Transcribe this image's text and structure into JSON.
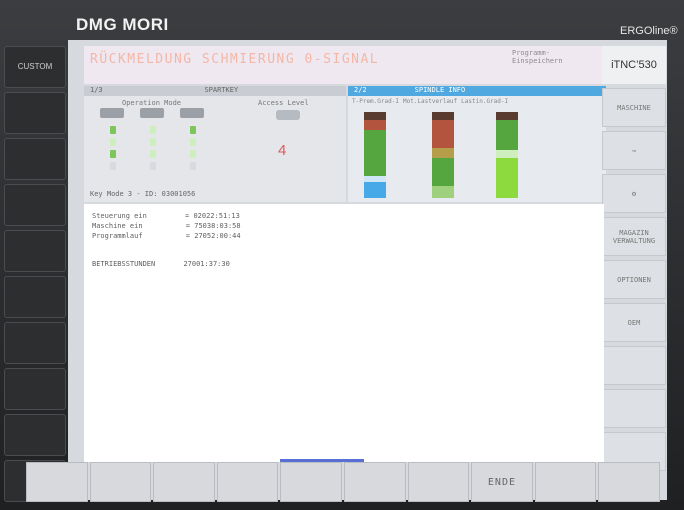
{
  "header": {
    "brand": "DMG MORI",
    "product": "ERGOline®",
    "control": "iTNC’530"
  },
  "left_keys": {
    "custom_label": "CUSTOM"
  },
  "top_message": {
    "text": "RÜCKMELDUNG SCHMIERUNG 0-SIGNAL",
    "program_label": "Programm-\nEinspeichern"
  },
  "panels": {
    "a": {
      "page": "1/3",
      "title": "SPARTKEY",
      "operation_mode_label": "Operation Mode",
      "access_level_label": "Access Level",
      "access_level_value": "4",
      "key_mode": "Key Mode 3 - ID: 03001056"
    },
    "b": {
      "page": "2/2",
      "title": "SPINDLE INFO",
      "labels": [
        "T-Prem.Grad-I",
        "Mot.Lastverlauf",
        "Lastin.Grad-I"
      ]
    }
  },
  "softkeys_right": [
    "MASCHINE",
    "",
    "",
    "MAGAZIN\nVERWALTUNG",
    "OPTIONEN",
    "OEM",
    "",
    "",
    ""
  ],
  "content": {
    "lines": [
      {
        "label": "Steuerung ein",
        "value": "= 02022:51:13"
      },
      {
        "label": "Maschine ein",
        "value": "= 75038:03:58"
      },
      {
        "label": "Programmlauf",
        "value": "= 27052:00:44"
      }
    ],
    "operating_hours": {
      "label": "BETRIEBSSTUNDEN",
      "value": "27001:37:30"
    }
  },
  "softkeys_bottom": [
    "",
    "",
    "",
    "",
    "",
    "",
    "",
    "ENDE",
    "",
    ""
  ],
  "colors": {
    "accent": "#4fa8df",
    "alert_text": "#f4b7a6",
    "level_text": "#e05b5b"
  }
}
